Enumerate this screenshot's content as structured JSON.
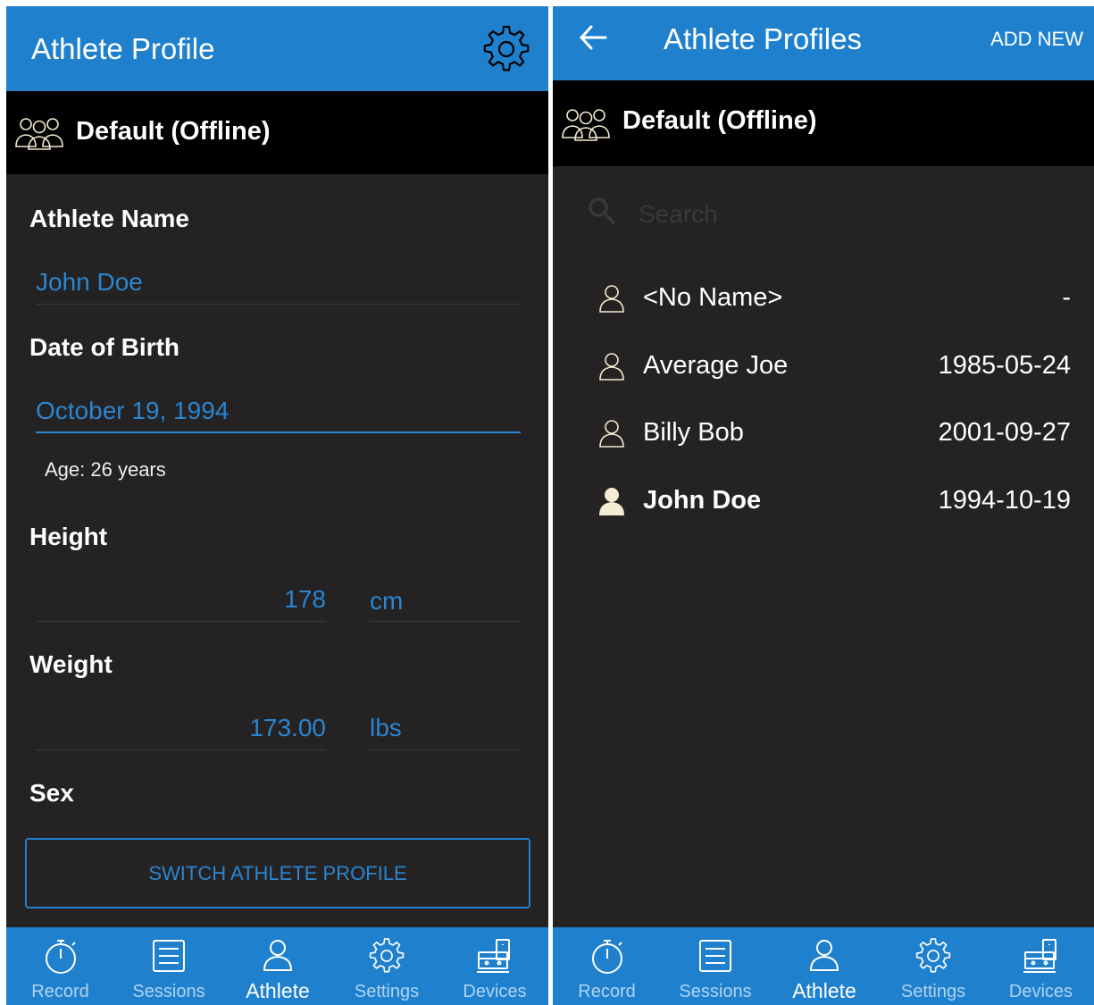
{
  "left": {
    "title": "Athlete Profile",
    "profile_bar": "Default (Offline)",
    "athlete_name_label": "Athlete Name",
    "athlete_name_value": "John Doe",
    "dob_label": "Date of Birth",
    "dob_value": "October 19, 1994",
    "age_text": "Age: 26 years",
    "height_label": "Height",
    "height_value": "178",
    "height_unit": "cm",
    "weight_label": "Weight",
    "weight_value": "173.00",
    "weight_unit": "lbs",
    "sex_label": "Sex",
    "switch_button": "SWITCH ATHLETE PROFILE"
  },
  "right": {
    "title": "Athlete Profiles",
    "add_new": "ADD NEW",
    "profile_bar": "Default (Offline)",
    "search_placeholder": "Search",
    "athletes": [
      {
        "name": "<No Name>",
        "date": "-"
      },
      {
        "name": "Average Joe",
        "date": "1985-05-24"
      },
      {
        "name": "Billy Bob",
        "date": "2001-09-27"
      },
      {
        "name": "John Doe",
        "date": "1994-10-19",
        "selected": true
      }
    ]
  },
  "nav": {
    "items": [
      {
        "label": "Record",
        "icon": "stopwatch-icon"
      },
      {
        "label": "Sessions",
        "icon": "list-icon"
      },
      {
        "label": "Athlete",
        "icon": "person-icon",
        "active": true
      },
      {
        "label": "Settings",
        "icon": "gear-icon"
      },
      {
        "label": "Devices",
        "icon": "devices-icon"
      }
    ]
  },
  "colors": {
    "primary": "#1f80cd",
    "accent_text": "#2a86d0",
    "background": "#242222",
    "profile_bar": "#000000",
    "icon_beige": "#f3ecd0"
  }
}
